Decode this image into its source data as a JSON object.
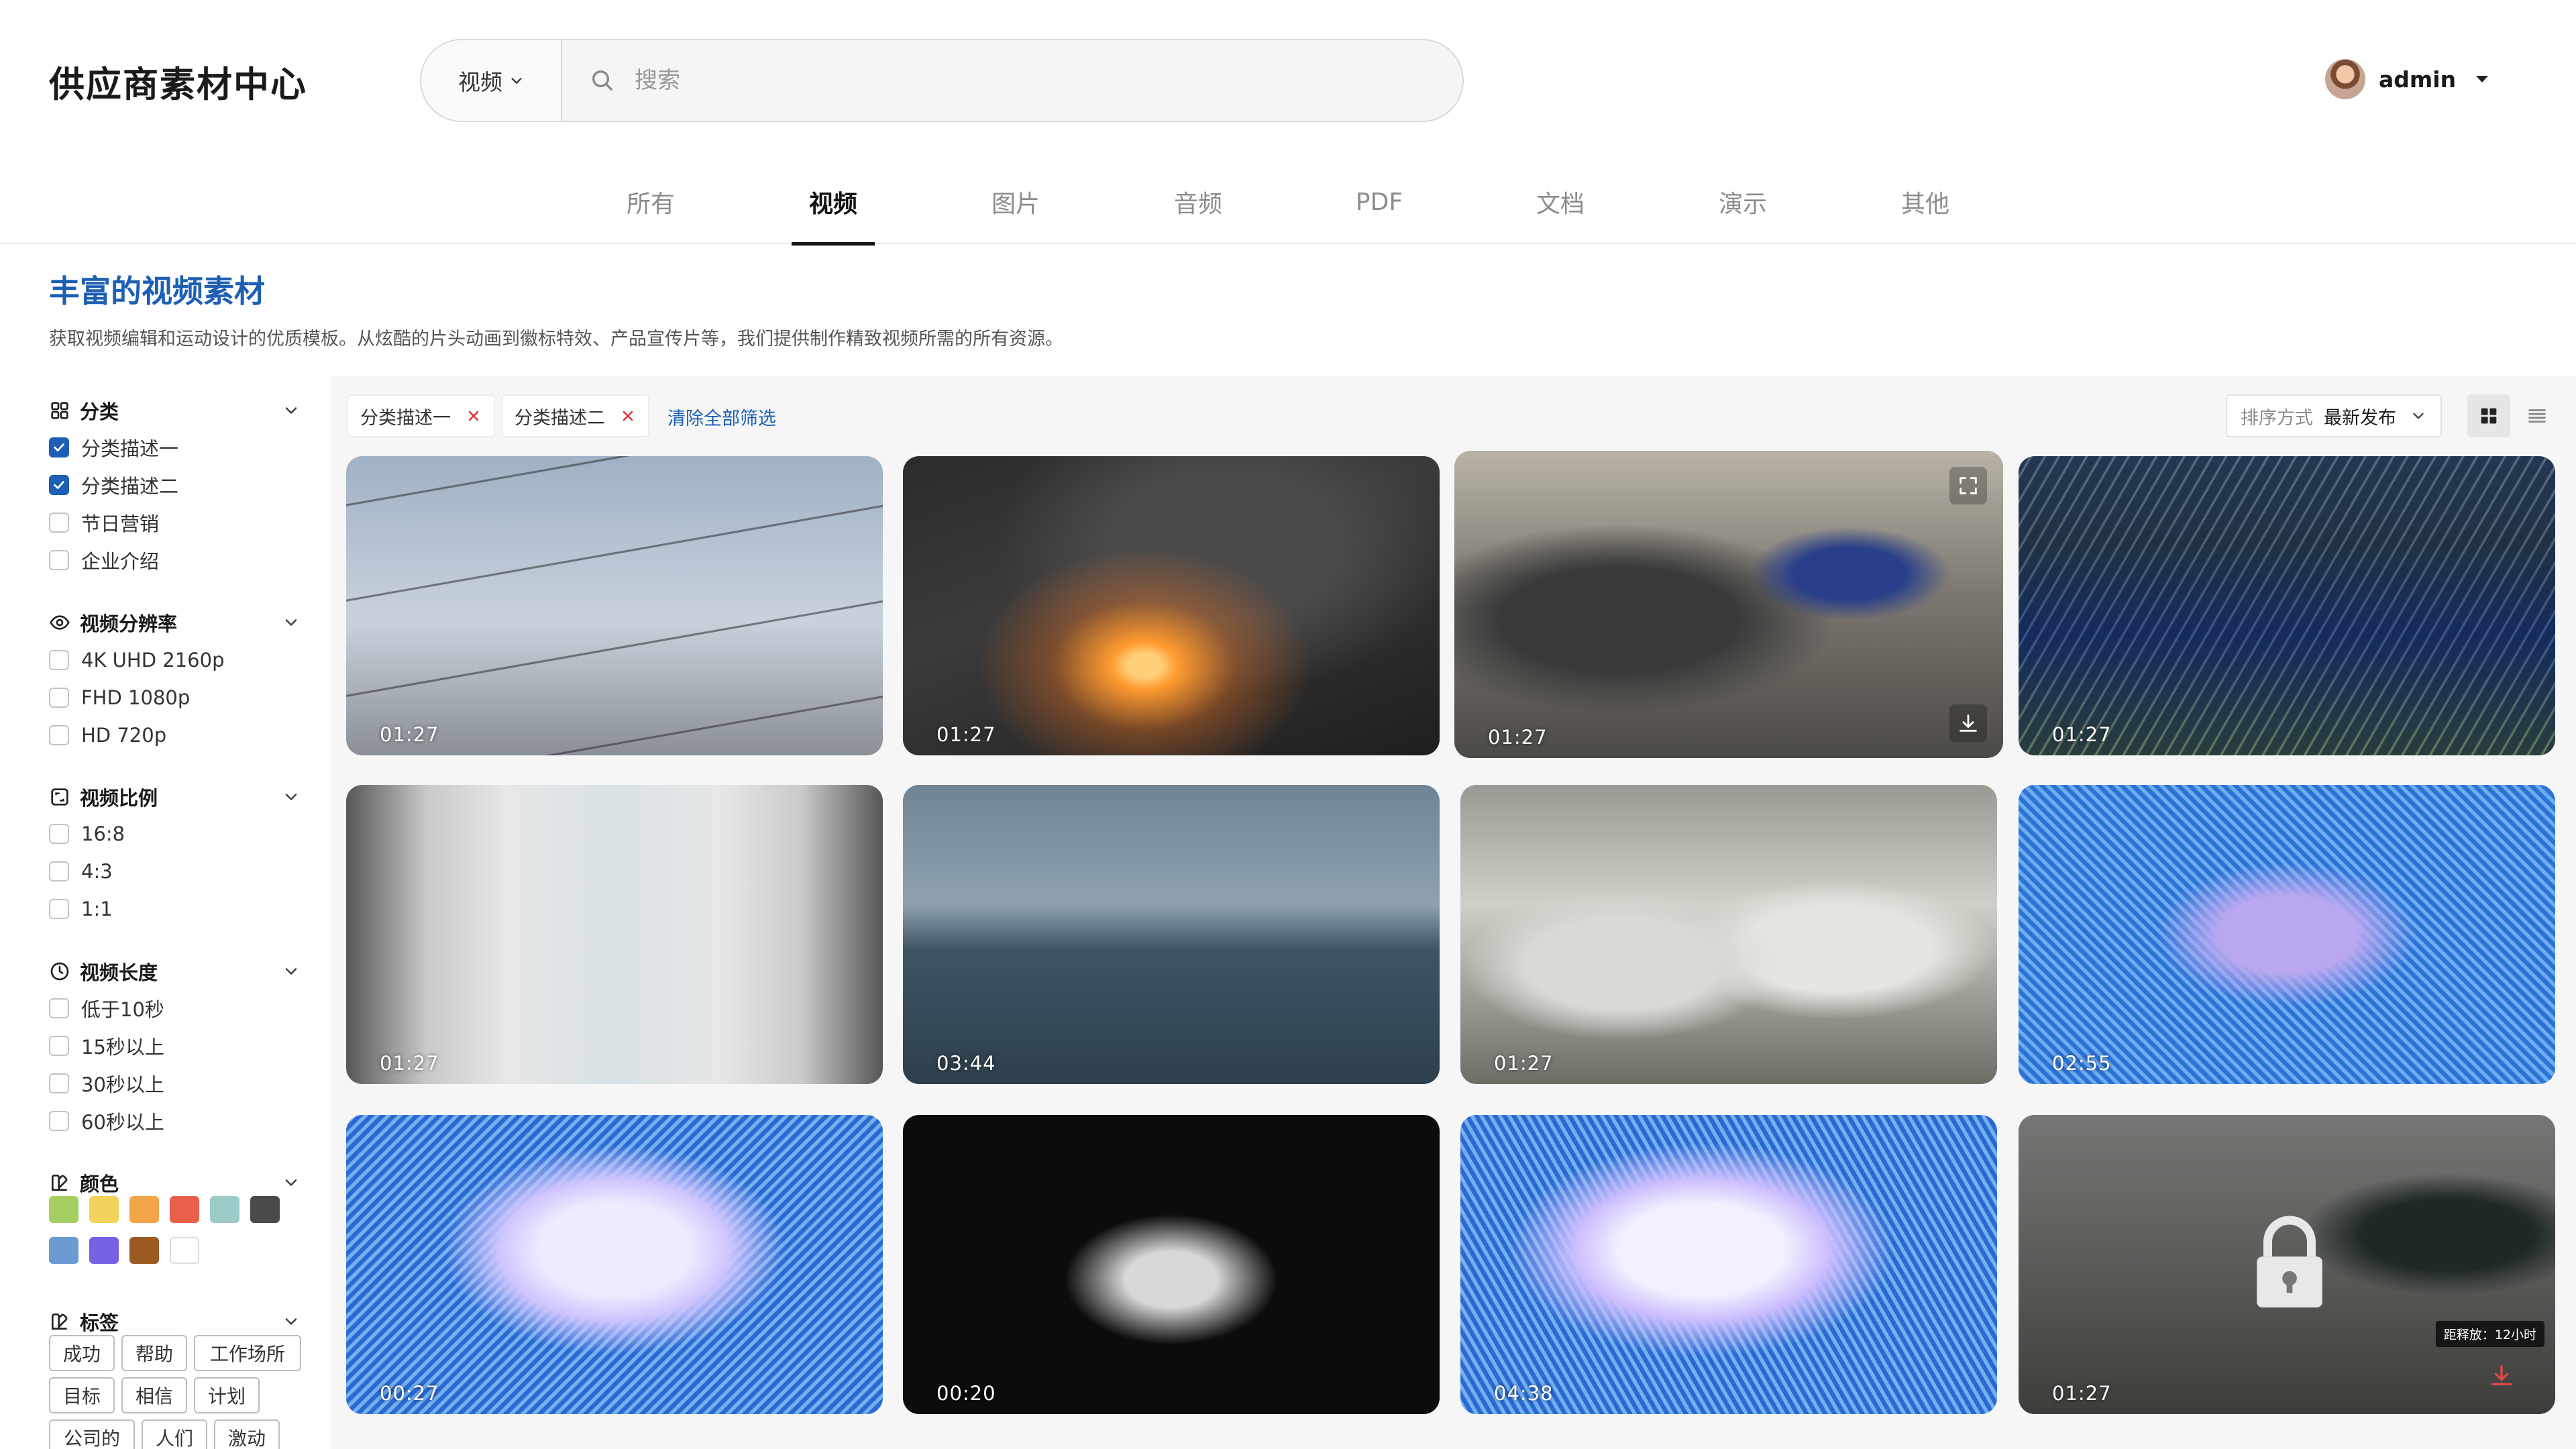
{
  "header": {
    "logo": "供应商素材中心",
    "search_type": "视频",
    "search_placeholder": "搜索",
    "username": "admin"
  },
  "tabs": [
    "所有",
    "视频",
    "图片",
    "音频",
    "PDF",
    "文档",
    "演示",
    "其他"
  ],
  "active_tab": "视频",
  "page": {
    "title": "丰富的视频素材",
    "description": "获取视频编辑和运动设计的优质模板。从炫酷的片头动画到徽标特效、产品宣传片等，我们提供制作精致视频所需的所有资源。"
  },
  "filters": {
    "category": {
      "title": "分类",
      "options": [
        {
          "label": "分类描述一",
          "checked": true
        },
        {
          "label": "分类描述二",
          "checked": true
        },
        {
          "label": "节日营销",
          "checked": false
        },
        {
          "label": "企业介绍",
          "checked": false
        }
      ]
    },
    "resolution": {
      "title": "视频分辨率",
      "options": [
        {
          "label": "4K UHD 2160p",
          "checked": false
        },
        {
          "label": "FHD 1080p",
          "checked": false
        },
        {
          "label": "HD 720p",
          "checked": false
        }
      ]
    },
    "ratio": {
      "title": "视频比例",
      "options": [
        {
          "label": "16:8",
          "checked": false
        },
        {
          "label": "4:3",
          "checked": false
        },
        {
          "label": "1:1",
          "checked": false
        }
      ]
    },
    "length": {
      "title": "视频长度",
      "options": [
        {
          "label": "低于10秒",
          "checked": false
        },
        {
          "label": "15秒以上",
          "checked": false
        },
        {
          "label": "30秒以上",
          "checked": false
        },
        {
          "label": "60秒以上",
          "checked": false
        }
      ]
    },
    "color": {
      "title": "颜色",
      "swatches": [
        "#a6cf62",
        "#f2d45c",
        "#f4a549",
        "#e9604a",
        "#9ccbc7",
        "#4a4a4a",
        "#6b9bd2",
        "#7563e6",
        "#9b5a22",
        "#ffffff"
      ]
    },
    "tags": {
      "title": "标签",
      "items": [
        "成功",
        "帮助",
        "工作场所",
        "目标",
        "相信",
        "计划",
        "公司的",
        "人们",
        "激动"
      ]
    }
  },
  "active_filters": [
    "分类描述一",
    "分类描述二"
  ],
  "clear_all": "清除全部筛选",
  "sort": {
    "label": "排序方式",
    "value": "最新发布"
  },
  "videos": [
    {
      "duration": "01:27"
    },
    {
      "duration": "01:27"
    },
    {
      "duration": "01:27"
    },
    {
      "duration": "01:27"
    },
    {
      "duration": "01:27"
    },
    {
      "duration": "03:44"
    },
    {
      "duration": "01:27"
    },
    {
      "duration": "02:55"
    },
    {
      "duration": "00:27"
    },
    {
      "duration": "00:20"
    },
    {
      "duration": "04:38"
    },
    {
      "duration": "01:27",
      "locked": true,
      "release_tip": "距释放：12小时"
    }
  ],
  "colors": {
    "accent": "#1d5fb4",
    "remove_x": "#d9363e"
  }
}
